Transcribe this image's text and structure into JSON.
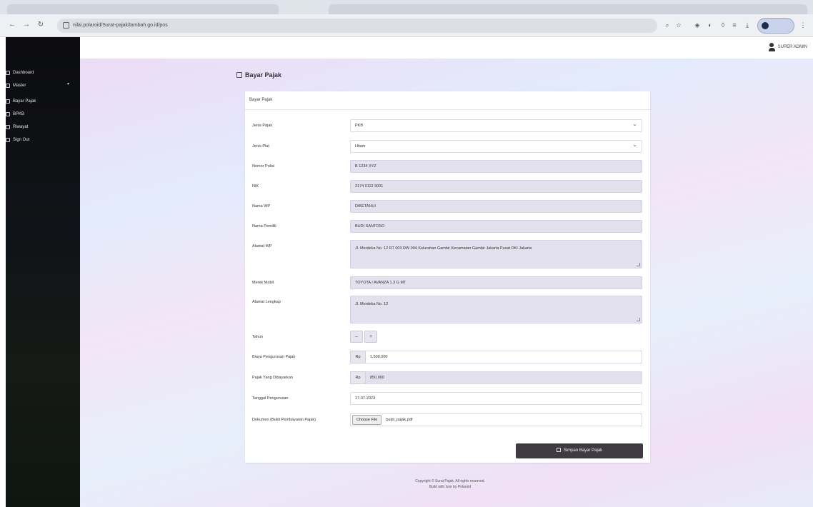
{
  "browser": {
    "url": "nilai.polaroid/Surat-pajak/tambah.go.id/pos"
  },
  "sidebar": {
    "items": [
      {
        "label": "Dashboard",
        "icon": "home-icon"
      },
      {
        "label": "Master",
        "icon": "folder-icon"
      },
      {
        "label": "Bayar Pajak",
        "icon": "receipt-icon"
      },
      {
        "label": "BPKB",
        "icon": "document-icon"
      },
      {
        "label": "Riwayat",
        "icon": "history-icon"
      },
      {
        "label": "Sign Out",
        "icon": "logout-icon"
      }
    ]
  },
  "topbar": {
    "user_name": "SUPER ADMIN"
  },
  "page": {
    "title": "Bayar Pajak",
    "card_header": "Bayar Pajak"
  },
  "form": {
    "jenis_pajak": {
      "label": "Jenis Pajak",
      "value": "PKB"
    },
    "jenis_plat": {
      "label": "Jenis Plat",
      "value": "Hitam"
    },
    "nomor_polisi": {
      "label": "Nomor Polisi",
      "value": "B 1234 XYZ"
    },
    "nik": {
      "label": "NIK",
      "value": "3174 0112 9001"
    },
    "nama_wp": {
      "label": "Nama WP",
      "value": "DIKETAHUI"
    },
    "nama_pemilik": {
      "label": "Nama Pemilik",
      "value": "BUDI SANTOSO"
    },
    "alamat_wp": {
      "label": "Alamat WP",
      "value": "Jl. Merdeka No. 12 RT 003 RW 004 Kelurahan Gambir Kecamatan Gambir Jakarta Pusat DKI Jakarta"
    },
    "merek_mobil": {
      "label": "Merek Mobil",
      "value": "TOYOTA / AVANZA 1.3 G MT"
    },
    "alamat_lengkap": {
      "label": "Alamat Lengkap",
      "value": "Jl. Merdeka No. 12"
    },
    "tahun": {
      "label": "Tahun",
      "minus": "–",
      "plus": "+"
    },
    "biaya": {
      "label": "Biaya Pengurusan Pajak",
      "prefix": "Rp",
      "value": "1.500.000"
    },
    "pajak": {
      "label": "Pajak Yang Dibayarkan",
      "prefix": "Rp",
      "value": "850.000"
    },
    "tanggal": {
      "label": "Tanggal Pengurusan",
      "value": "17-07-2023"
    },
    "dokumen": {
      "label": "Dokumen (Bukti Pembayaran Pajak)",
      "button": "Choose File",
      "filename": "bukti_pajak.pdf"
    }
  },
  "actions": {
    "submit_label": "Simpan Bayar Pajak"
  },
  "footer": {
    "line1": "Copyright © Surat Pajak. All rights reserved.",
    "line2": "Build with love by Polaroid"
  }
}
